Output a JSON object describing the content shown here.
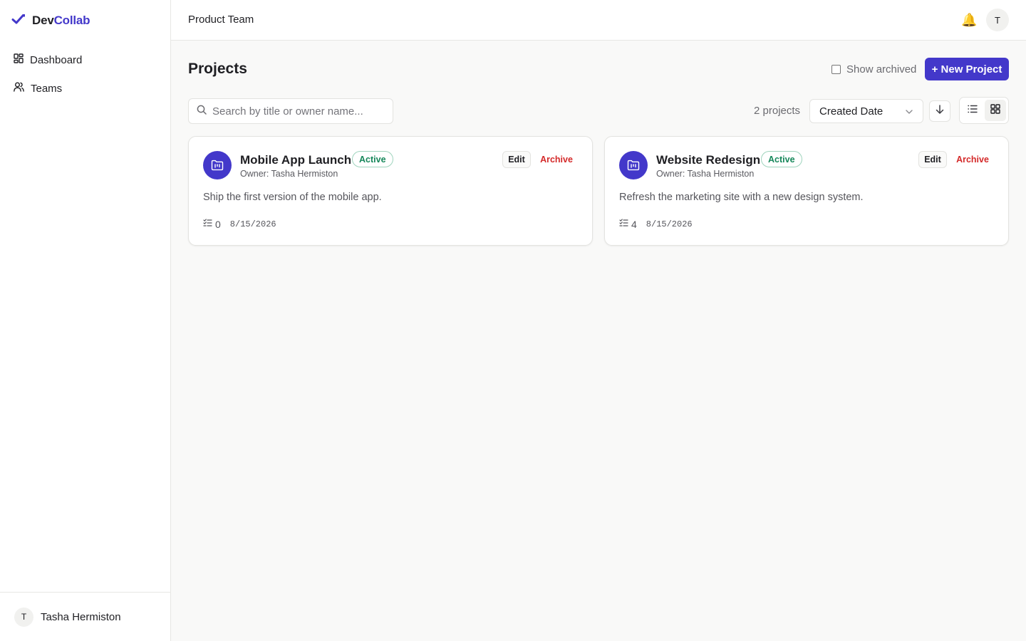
{
  "brand": {
    "part1": "Dev",
    "part2": "Collab",
    "accent": "#4338ca"
  },
  "sidebar": {
    "items": [
      {
        "label": "Dashboard",
        "icon": "dashboard-grid-icon"
      },
      {
        "label": "Teams",
        "icon": "users-icon"
      }
    ],
    "user": {
      "initial": "T",
      "name": "Tasha Hermiston"
    }
  },
  "header": {
    "team": "Product Team",
    "notifications_icon": "bell-icon",
    "avatar_initial": "T"
  },
  "page": {
    "title": "Projects",
    "show_archived_label": "Show archived",
    "show_archived_checked": false,
    "new_project_label": "+ New Project"
  },
  "toolbar": {
    "search_placeholder": "Search by title or owner name...",
    "search_value": "",
    "count_label": "2 projects",
    "sort_selected": "Created Date",
    "sort_direction": "descending",
    "view_mode": "grid"
  },
  "projects": [
    {
      "title": "Mobile App Launch",
      "status": "Active",
      "owner": "Owner: Tasha Hermiston",
      "description": "Ship the first version of the mobile app.",
      "task_count": "0",
      "date": "8/15/2026",
      "edit_label": "Edit",
      "archive_label": "Archive"
    },
    {
      "title": "Website Redesign",
      "status": "Active",
      "owner": "Owner: Tasha Hermiston",
      "description": "Refresh the marketing site with a new design system.",
      "task_count": "4",
      "date": "8/15/2026",
      "edit_label": "Edit",
      "archive_label": "Archive"
    }
  ],
  "colors": {
    "primary": "#4338ca",
    "status_active": "#16875a",
    "danger": "#d42a2a"
  }
}
